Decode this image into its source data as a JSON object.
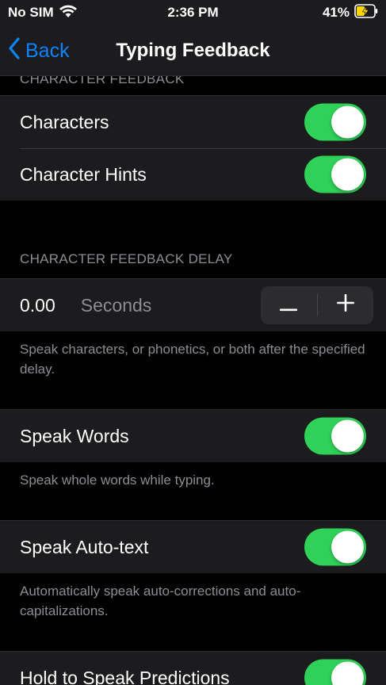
{
  "status_bar": {
    "carrier": "No SIM",
    "time": "2:36 PM",
    "battery": "41%"
  },
  "nav": {
    "back_label": "Back",
    "title": "Typing Feedback"
  },
  "sections": {
    "character_feedback": {
      "header": "CHARACTER FEEDBACK",
      "items": [
        {
          "label": "Characters",
          "toggle_on": true
        },
        {
          "label": "Character Hints",
          "toggle_on": true
        }
      ]
    },
    "character_feedback_delay": {
      "header": "CHARACTER FEEDBACK DELAY",
      "value": "0.00",
      "unit": "Seconds",
      "footer": "Speak characters, or phonetics, or both after the specified delay."
    },
    "speak_words": {
      "label": "Speak Words",
      "toggle_on": true,
      "footer": "Speak whole words while typing."
    },
    "speak_auto_text": {
      "label": "Speak Auto-text",
      "toggle_on": true,
      "footer": "Automatically speak auto-corrections and auto-capitalizations."
    },
    "hold_to_speak": {
      "label": "Hold to Speak Predictions",
      "toggle_on": true
    }
  },
  "colors": {
    "accent": "#0a84ff",
    "toggle_on": "#30d158",
    "background": "#000000",
    "cell_background": "#1c1c1e",
    "secondary_text": "#8d8d93"
  }
}
